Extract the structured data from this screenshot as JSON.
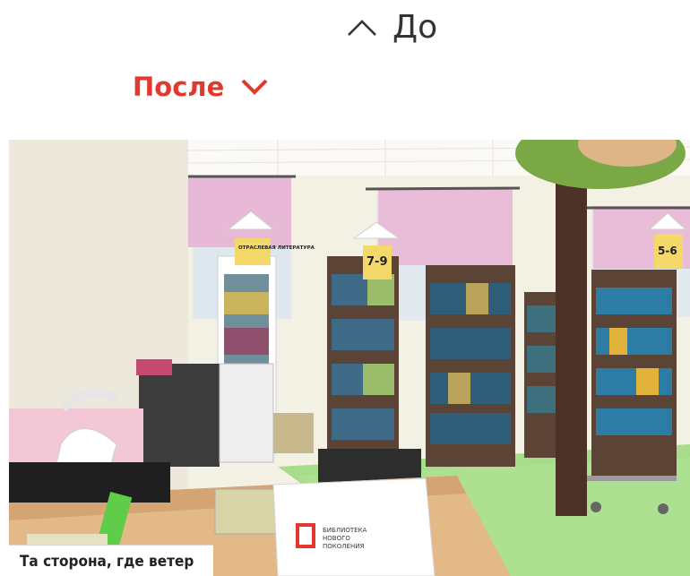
{
  "toggle_before": {
    "label": "До",
    "icon": "chevron-up-icon"
  },
  "toggle_after": {
    "label": "После",
    "icon": "chevron-down-icon",
    "color": "#e2392e"
  },
  "photo": {
    "shelf_tags": [
      "ОТРАСЛЕВАЯ ЛИТЕРАТУРА",
      "7-9",
      "5-6"
    ],
    "desk_sign": {
      "line1": "БИБЛИОТЕКА",
      "line2": "НОВОГО",
      "line3": "ПОКОЛЕНИЯ"
    },
    "caption": "Та сторона, где ветер"
  }
}
